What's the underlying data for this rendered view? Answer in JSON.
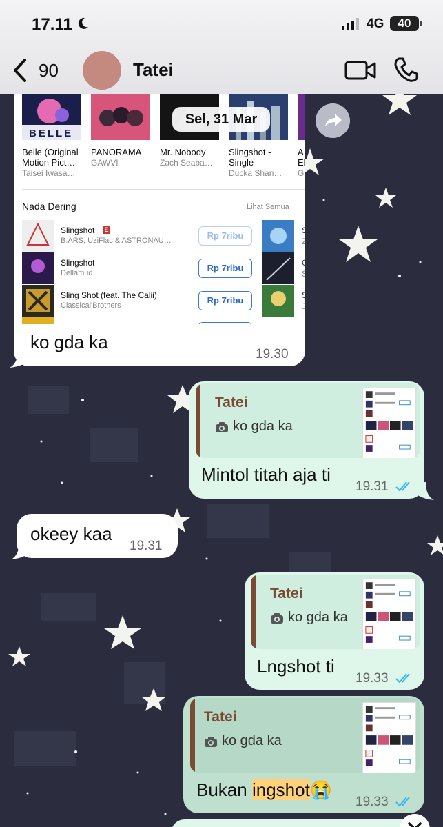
{
  "status_bar": {
    "time": "17.11",
    "network": "4G",
    "battery": "40"
  },
  "header": {
    "unread_count": "90",
    "contact_name": "Tatei"
  },
  "date_separator": "Sel, 31 Mar",
  "shared_screenshot": {
    "albums": [
      {
        "title_line1": "Belle (Original",
        "title_line2": "Motion Pict…",
        "artist": "Taisei Iwasa…",
        "cover_text": "BELLE"
      },
      {
        "title_line1": "PANORAMA",
        "title_line2": "",
        "artist": "GAWVI",
        "cover_text": ""
      },
      {
        "title_line1": "Mr. Nobody",
        "title_line2": "",
        "artist": "Zach Seaba…",
        "cover_text": ""
      },
      {
        "title_line1": "Slingshot -",
        "title_line2": "Single",
        "artist": "Ducka Shan…",
        "cover_text": ""
      },
      {
        "title_line1": "A",
        "title_line2": "El",
        "artist": "G",
        "cover_text": ""
      }
    ],
    "section_title": "Nada Dering",
    "see_all": "Lihat Semua",
    "ringtones": [
      {
        "title": "Slingshot",
        "explicit": "E",
        "artist": "B.ARS, UziFlac & ASTRONAU…",
        "price": "Rp 7ribu",
        "side": "S",
        "side_sub": "Z"
      },
      {
        "title": "Slingshot",
        "artist": "Dellamud",
        "price": "Rp 7ribu",
        "side": "G",
        "side_sub": "S"
      },
      {
        "title": "Sling Shot (feat. The Calii)",
        "artist": "Classical'Brothers",
        "price": "Rp 7ribu",
        "side": "S",
        "side_sub": "J"
      }
    ]
  },
  "messages": [
    {
      "direction": "in",
      "text": "ko gda ka",
      "time": "19.30"
    },
    {
      "direction": "out",
      "quote_name": "Tatei",
      "quote_text": "ko gda ka",
      "text": "Mintol titah aja ti",
      "time": "19.31"
    },
    {
      "direction": "in",
      "text": "okeey kaa",
      "time": "19.31"
    },
    {
      "direction": "out",
      "quote_name": "Tatei",
      "quote_text": "ko gda ka",
      "text": "Lngshot ti",
      "time": "19.33"
    },
    {
      "direction": "out",
      "quote_name": "Tatei",
      "quote_text": "ko gda ka",
      "text_before": "Bukan ",
      "text_highlight": "ingshot",
      "emoji": "😭",
      "time": "19.33"
    }
  ],
  "colors": {
    "incoming_bubble": "#ffffff",
    "outgoing_bubble": "#dff7ea",
    "quote_accent": "#7a4a33",
    "read_ticks": "#34b7f1",
    "price_blue": "#2a6ac8"
  }
}
